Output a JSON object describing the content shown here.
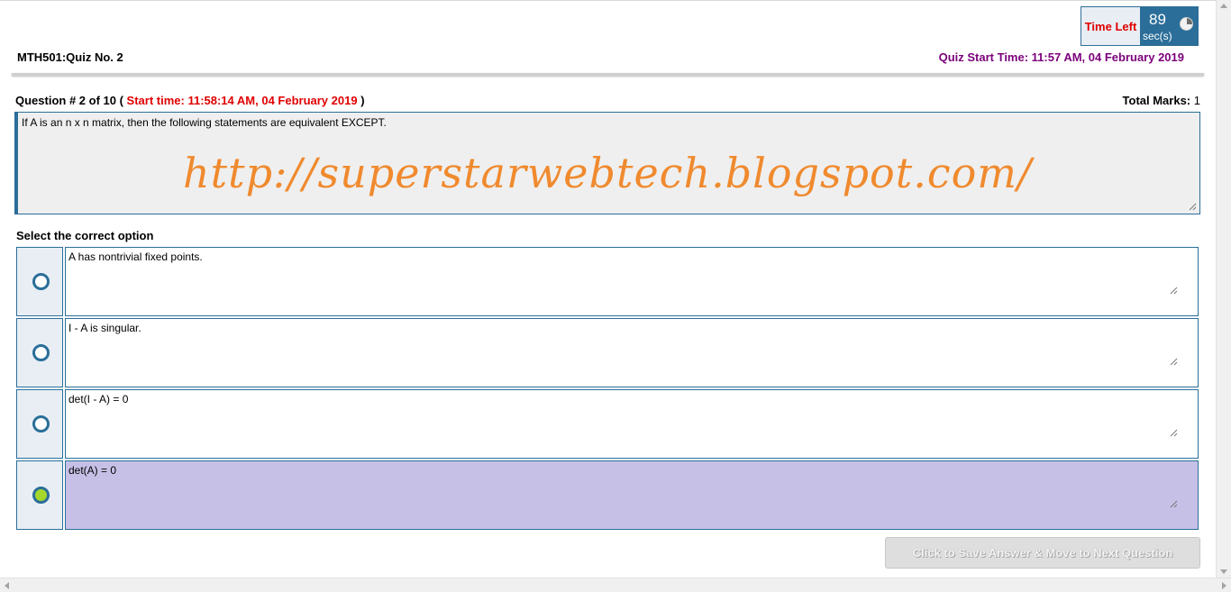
{
  "timer": {
    "label": "Time Left",
    "value": "89",
    "unit": "sec(s)",
    "icon": "clock-icon"
  },
  "header": {
    "quiz_title": "MTH501:Quiz No. 2",
    "quiz_start": "Quiz Start Time: 11:57 AM, 04 February 2019"
  },
  "question": {
    "heading_prefix": "Question # 2 of 10 (",
    "start_time": "Start time: 11:58:14 AM, 04 February 2019",
    "heading_suffix": ")",
    "total_marks_label": "Total Marks:",
    "total_marks_value": "1",
    "text": "If A is an n x n matrix, then the following statements are equivalent EXCEPT.",
    "watermark": "http://superstarwebtech.blogspot.com/"
  },
  "options_label": "Select the correct option",
  "options": [
    {
      "text": "A has nontrivial fixed points.",
      "selected": false
    },
    {
      "text": "I - A is singular.",
      "selected": false
    },
    {
      "text": "det(I - A) = 0",
      "selected": false
    },
    {
      "text": "det(A) = 0",
      "selected": true
    }
  ],
  "next_button": {
    "label": "Click to Save Answer & Move to Next Question",
    "enabled": false
  },
  "colors": {
    "accent": "#2a6e99",
    "alert": "#e00000",
    "quiz_start": "#7b007b",
    "selected_option": "#c7c0e6",
    "selected_radio": "#a6d82b",
    "watermark": "#f08a2e"
  }
}
